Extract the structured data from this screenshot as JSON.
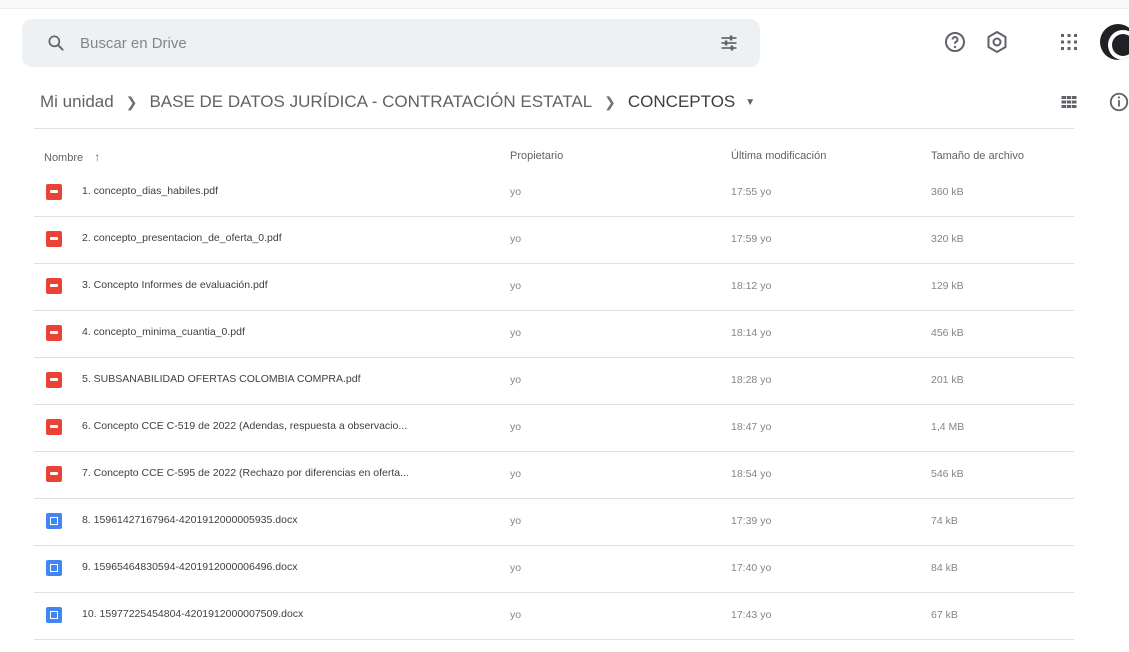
{
  "search": {
    "placeholder": "Buscar en Drive"
  },
  "breadcrumb": [
    {
      "label": "Mi unidad"
    },
    {
      "label": "BASE DE DATOS JURÍDICA - CONTRATACIÓN ESTATAL"
    },
    {
      "label": "CONCEPTOS"
    }
  ],
  "table": {
    "columns": {
      "name": "Nombre",
      "owner": "Propietario",
      "modified": "Última modificación",
      "size": "Tamaño de archivo"
    },
    "rows": [
      {
        "type": "pdf",
        "name": "1. concepto_dias_habiles.pdf",
        "owner": "yo",
        "modified": "17:55 yo",
        "size": "360 kB"
      },
      {
        "type": "pdf",
        "name": "2. concepto_presentacion_de_oferta_0.pdf",
        "owner": "yo",
        "modified": "17:59 yo",
        "size": "320 kB"
      },
      {
        "type": "pdf",
        "name": "3. Concepto Informes de evaluación.pdf",
        "owner": "yo",
        "modified": "18:12 yo",
        "size": "129 kB"
      },
      {
        "type": "pdf",
        "name": "4. concepto_minima_cuantia_0.pdf",
        "owner": "yo",
        "modified": "18:14 yo",
        "size": "456 kB"
      },
      {
        "type": "pdf",
        "name": "5. SUBSANABILIDAD OFERTAS COLOMBIA COMPRA.pdf",
        "owner": "yo",
        "modified": "18:28 yo",
        "size": "201 kB"
      },
      {
        "type": "pdf",
        "name": "6. Concepto CCE C-519 de 2022 (Adendas, respuesta a observacio...",
        "owner": "yo",
        "modified": "18:47 yo",
        "size": "1,4 MB"
      },
      {
        "type": "pdf",
        "name": "7. Concepto CCE C-595 de 2022 (Rechazo por diferencias en oferta...",
        "owner": "yo",
        "modified": "18:54 yo",
        "size": "546 kB"
      },
      {
        "type": "doc",
        "name": "8. 15961427167964-4201912000005935.docx",
        "owner": "yo",
        "modified": "17:39 yo",
        "size": "74 kB"
      },
      {
        "type": "doc",
        "name": "9. 15965464830594-4201912000006496.docx",
        "owner": "yo",
        "modified": "17:40 yo",
        "size": "84 kB"
      },
      {
        "type": "doc",
        "name": "10. 15977225454804-4201912000007509.docx",
        "owner": "yo",
        "modified": "17:43 yo",
        "size": "67 kB"
      }
    ]
  },
  "icons": {
    "search": "search-icon",
    "filter": "search-options-icon",
    "help": "help-icon",
    "settings": "settings-icon",
    "apps": "apps-grid-icon",
    "view": "grid-view-icon",
    "info": "info-icon",
    "sort": "arrow-up-icon"
  },
  "colors": {
    "pdf": "#ea4335",
    "doc": "#4285f4"
  }
}
